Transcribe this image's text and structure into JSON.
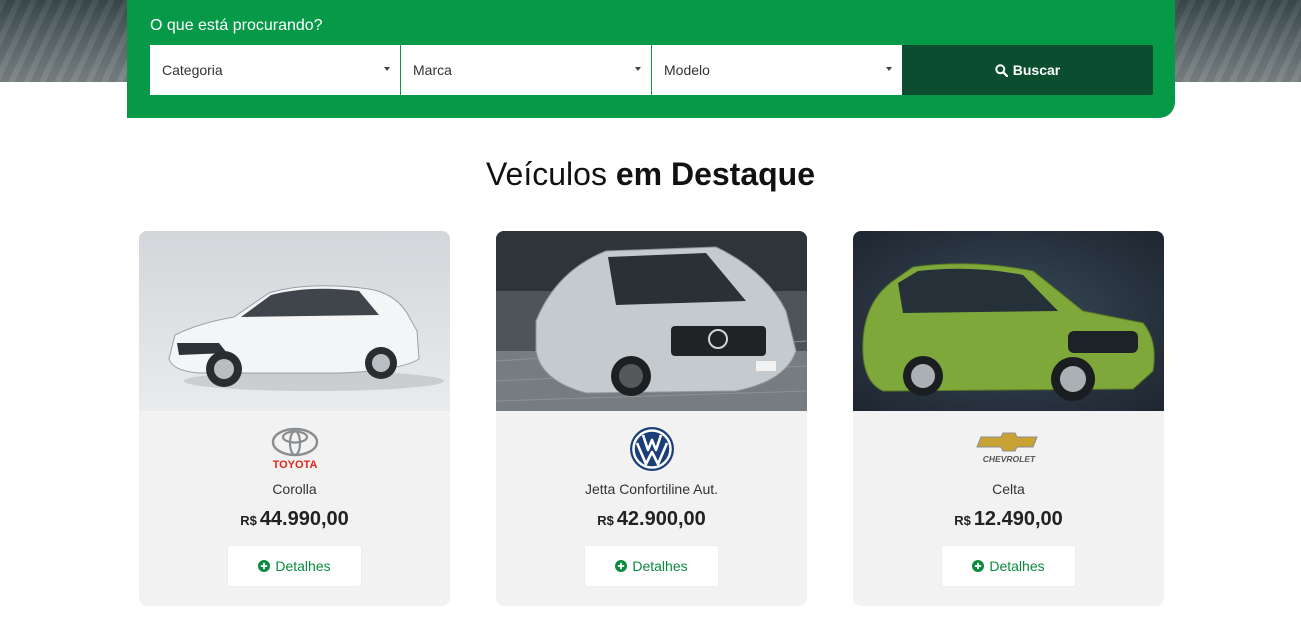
{
  "search": {
    "title": "O que está procurando?",
    "category_value": "Categoria",
    "brand_value": "Marca",
    "model_value": "Modelo",
    "button_label": "Buscar",
    "button_icon": "search-icon"
  },
  "section": {
    "title_light": "Veículos ",
    "title_bold": "em Destaque"
  },
  "colors": {
    "brand_green": "#069948",
    "dark_green": "#0a4d2f",
    "card_bg": "#f2f2f2"
  },
  "vehicles": [
    {
      "brand_logo": "toyota-logo",
      "brand_logo_text": "TOYOTA",
      "model": "Corolla",
      "currency": "R$",
      "price": "44.990,00",
      "details_label": "Detalhes",
      "details_icon": "plus-circle-icon",
      "car_color": "#f1f3f4"
    },
    {
      "brand_logo": "volkswagen-logo",
      "model": "Jetta Confortiline Aut.",
      "currency": "R$",
      "price": "42.900,00",
      "details_label": "Detalhes",
      "details_icon": "plus-circle-icon",
      "car_color": "#c4cace"
    },
    {
      "brand_logo": "chevrolet-logo",
      "brand_logo_text": "CHEVROLET",
      "model": "Celta",
      "currency": "R$",
      "price": "12.490,00",
      "details_label": "Detalhes",
      "details_icon": "plus-circle-icon",
      "car_color": "#7fa83a"
    }
  ]
}
